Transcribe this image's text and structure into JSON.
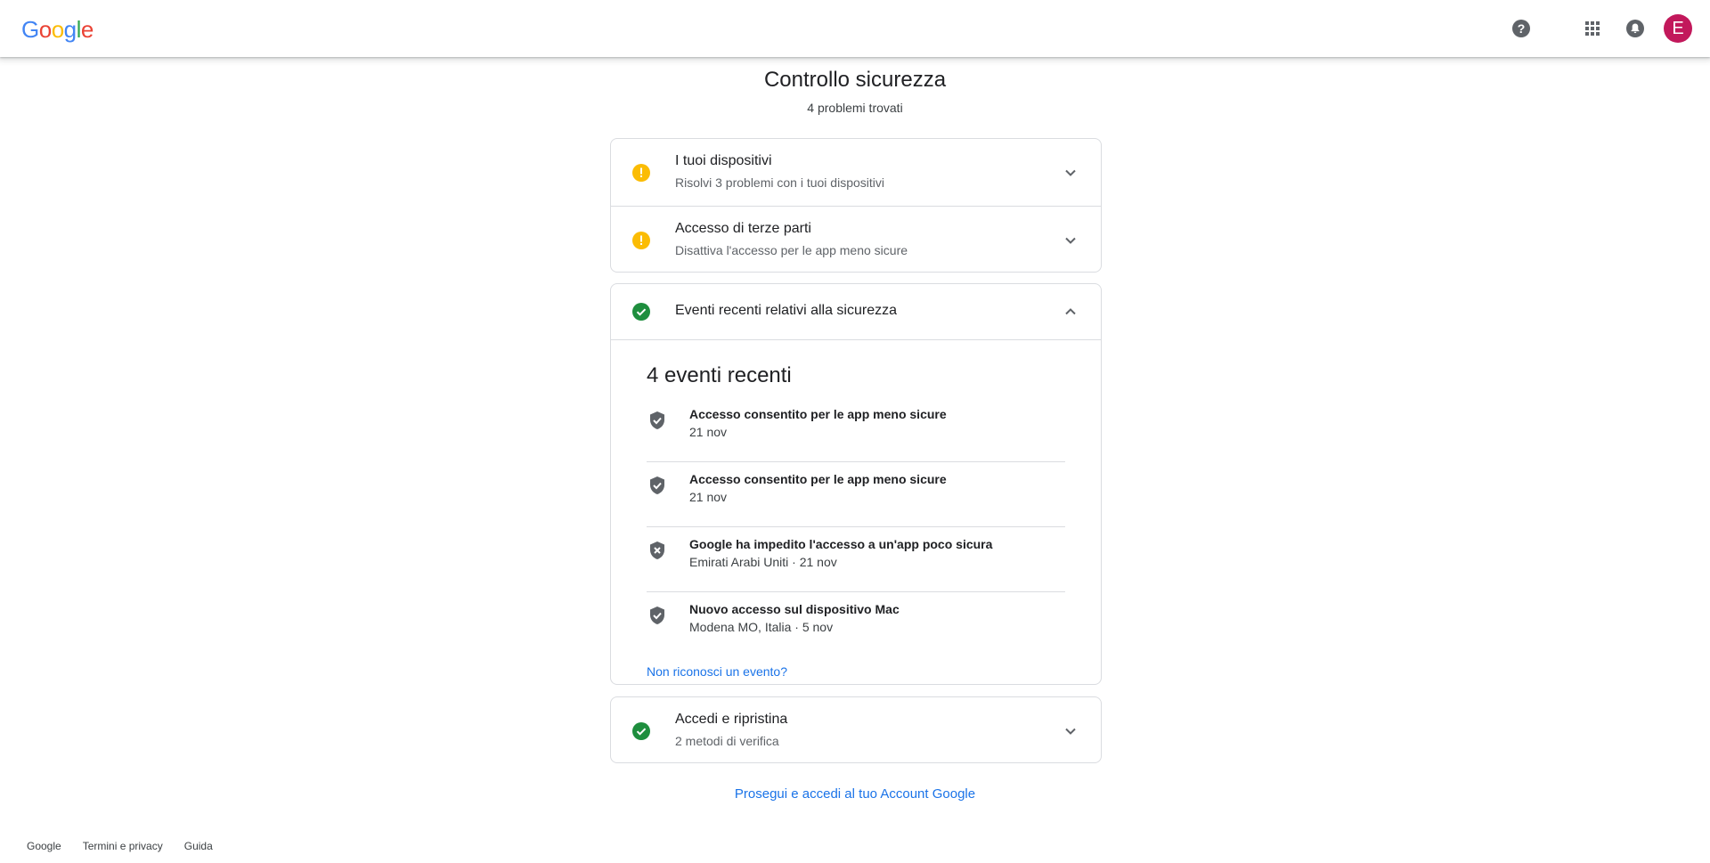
{
  "header": {
    "logo_letters": [
      {
        "ch": "G",
        "color": "#4285F4"
      },
      {
        "ch": "o",
        "color": "#EA4335"
      },
      {
        "ch": "o",
        "color": "#FBBC05"
      },
      {
        "ch": "g",
        "color": "#4285F4"
      },
      {
        "ch": "l",
        "color": "#34A853"
      },
      {
        "ch": "e",
        "color": "#EA4335"
      }
    ],
    "icons": [
      "help-icon",
      "apps-icon",
      "notifications-icon"
    ],
    "avatar_letter": "E",
    "avatar_color": "#c2185b"
  },
  "page": {
    "title": "Controllo sicurezza",
    "subtitle": "4 problemi trovati"
  },
  "issues": [
    {
      "title": "I tuoi dispositivi",
      "subtitle": "Risolvi 3 problemi con i tuoi dispositivi",
      "status": "warning"
    },
    {
      "title": "Accesso di terze parti",
      "subtitle": "Disattiva l'accesso per le app meno sicure",
      "status": "warning"
    }
  ],
  "recent_events_section": {
    "title": "Eventi recenti relativi alla sicurezza",
    "status": "ok",
    "expanded": true,
    "heading": "4 eventi recenti",
    "events": [
      {
        "title": "Accesso consentito per le app meno sicure",
        "subtitle": "21 nov",
        "icon": "shield-check-icon"
      },
      {
        "title": "Accesso consentito per le app meno sicure",
        "subtitle": "21 nov",
        "icon": "shield-check-icon"
      },
      {
        "title": "Google ha impedito l'accesso a un'app poco sicura",
        "subtitle": "Emirati Arabi Uniti · 21 nov",
        "icon": "shield-x-icon"
      },
      {
        "title": "Nuovo accesso sul dispositivo Mac",
        "subtitle": "Modena MO, Italia · 5 nov",
        "icon": "shield-check-icon"
      }
    ],
    "link": "Non riconosci un evento?"
  },
  "signin_section": {
    "title": "Accedi e ripristina",
    "subtitle": "2 metodi di verifica",
    "status": "ok"
  },
  "continue_link": "Prosegui e accedi al tuo Account Google",
  "footer": {
    "links": [
      "Google",
      "Termini e privacy",
      "Guida"
    ]
  },
  "colors": {
    "warning": "#fbbc04",
    "ok": "#1e8e3e",
    "link": "#1a73e8",
    "icon_gray": "#5f6368"
  }
}
